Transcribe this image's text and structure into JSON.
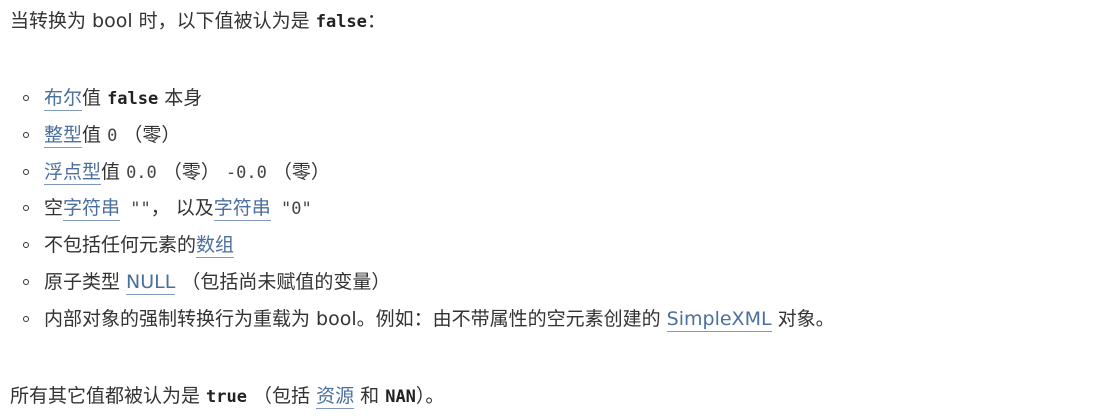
{
  "intro": {
    "before": "当转换为 bool 时，以下值被认为是 ",
    "code": "false",
    "after": "："
  },
  "items": [
    {
      "link": "布尔",
      "text1": "值 ",
      "code": "false",
      "text2": " 本身"
    },
    {
      "link": "整型",
      "text1": "值 ",
      "code": "0",
      "text2": " （零）"
    },
    {
      "link": "浮点型",
      "text1": "值 ",
      "code": "0.0",
      "text2": " （零） ",
      "code2": "-0.0",
      "text3": " （零）"
    },
    {
      "pre": "空",
      "link": "字符串",
      "code": " \"\"",
      "text1": "， 以及",
      "link2": "字符串",
      "code2": " \"0\""
    },
    {
      "pre": "不包括任何元素的",
      "link": "数组"
    },
    {
      "pre": "原子类型 ",
      "link": "NULL",
      "text1": " （包括尚未赋值的变量）"
    },
    {
      "pre": "内部对象的强制转换行为重载为 bool。例如：由不带属性的空元素创建的 ",
      "link": "SimpleXML",
      "text1": " 对象。"
    }
  ],
  "outro": {
    "before": "所有其它值都被认为是 ",
    "code": "true",
    "mid": " （包括 ",
    "link": "资源",
    "mid2": " 和 ",
    "code2": "NAN",
    "after": "）。"
  }
}
